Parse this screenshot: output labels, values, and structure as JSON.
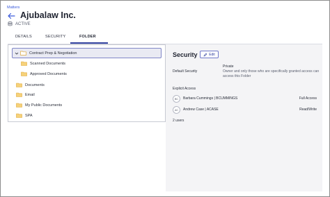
{
  "breadcrumb": "Matters",
  "matter": {
    "title": "Ajubalaw Inc.",
    "status": "ACTIVE"
  },
  "tabs": [
    {
      "label": "DETAILS"
    },
    {
      "label": "SECURITY"
    },
    {
      "label": "FOLDER",
      "active": true
    }
  ],
  "tree": {
    "selected": "Contract Prep & Negotiation",
    "children": [
      "Scanned Documents",
      "Approved Documents"
    ],
    "siblings": [
      "Documents",
      "Email",
      "My Public Documents",
      "SPA"
    ]
  },
  "security": {
    "title": "Security",
    "edit_label": "Edit",
    "default_label": "Default Security",
    "default_value": "Private",
    "default_desc": "Owner and only those who are specifically granted access can access this Folder",
    "explicit_label": "Explicit Access",
    "users": [
      {
        "initials": "BC",
        "name": "Barbara Cummings | BCUMMINGS",
        "access": "Full Access"
      },
      {
        "initials": "AC",
        "name": "Andrew Case | ACASE",
        "access": "Read/Write"
      }
    ],
    "count": "2 users"
  },
  "colors": {
    "accent": "#2f3f9e",
    "link": "#3b5bdb",
    "folder": "#f2c45a"
  }
}
